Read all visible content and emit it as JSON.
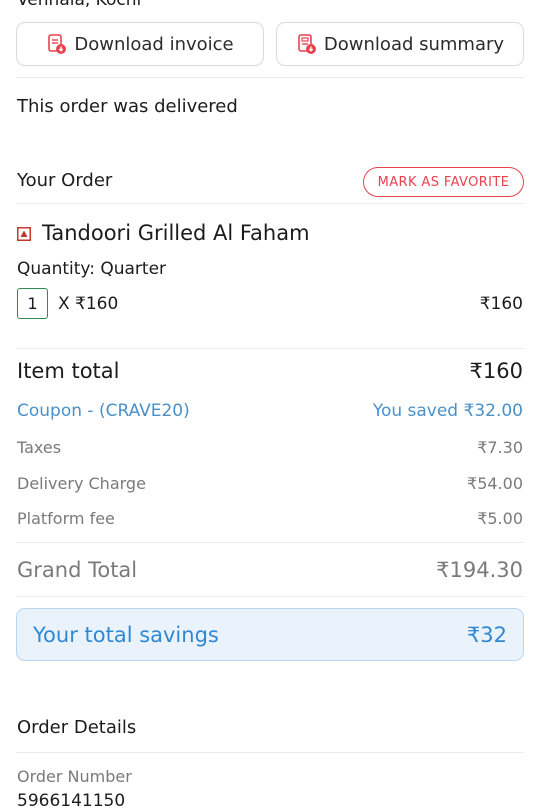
{
  "address": {
    "text": "Vennala, Kochi"
  },
  "buttons": {
    "download_invoice": "Download invoice",
    "download_summary": "Download summary"
  },
  "status": {
    "text": "This order was delivered"
  },
  "your_order": {
    "heading": "Your Order",
    "favorite_label": "MARK AS FAVORITE"
  },
  "item": {
    "name": "Tandoori Grilled Al Faham",
    "quantity_label": "Quantity: Quarter",
    "count": "1",
    "unit_price": "X ₹160",
    "line_total": "₹160"
  },
  "bill": {
    "item_total_label": "Item total",
    "item_total_value": "₹160",
    "coupon_label": "Coupon - (CRAVE20)",
    "coupon_value": "You saved ₹32.00",
    "taxes_label": "Taxes",
    "taxes_value": "₹7.30",
    "delivery_label": "Delivery Charge",
    "delivery_value": "₹54.00",
    "platform_label": "Platform fee",
    "platform_value": "₹5.00",
    "grand_label": "Grand Total",
    "grand_value": "₹194.30"
  },
  "savings": {
    "label": "Your total savings",
    "value": "₹32"
  },
  "order_details": {
    "heading": "Order Details",
    "number_label": "Order Number",
    "number_value": "5966141150"
  },
  "colors": {
    "accent_red": "#e8424f",
    "savings_blue": "#2f88d4",
    "veg_green": "#2e8b57"
  },
  "icons": {
    "invoice": "invoice-download-icon",
    "summary": "summary-download-icon",
    "nonveg": "non-veg-icon"
  }
}
